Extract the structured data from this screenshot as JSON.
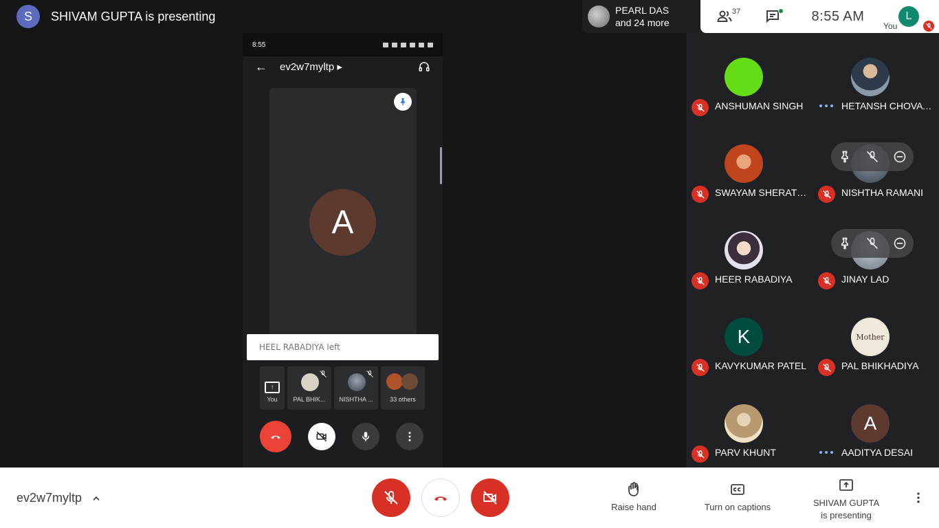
{
  "top_bar": {
    "presenter_initial": "S",
    "presenter_text": "SHIVAM GUPTA is presenting",
    "others_line1": "PEARL DAS",
    "others_line2": "and 24 more",
    "people_count": "37",
    "time": "8:55  AM",
    "you_initial": "L",
    "you_label": "You"
  },
  "phone": {
    "status_time": "8:55",
    "meeting_code": "ev2w7myltp",
    "main_tile_initial": "A",
    "toast": "HEEL RABADIYA left",
    "strip": [
      {
        "label": "You"
      },
      {
        "label": "PAL BHIK..."
      },
      {
        "label": "NISHTHA ..."
      },
      {
        "label": "33 others"
      }
    ]
  },
  "participants": [
    {
      "name": "ANSHUMAN SINGH",
      "avatar": "green-circle",
      "muted": true
    },
    {
      "name": "HETANSH CHOVAT...",
      "avatar": "photo",
      "muted": false
    },
    {
      "name": "SWAYAM SHERATH...",
      "avatar": "photo",
      "muted": true
    },
    {
      "name": "NISHTHA RAMANI",
      "avatar": "photo",
      "muted": true
    },
    {
      "name": "HEER RABADIYA",
      "avatar": "photo",
      "muted": true
    },
    {
      "name": "JINAY LAD",
      "avatar": "photo",
      "muted": true
    },
    {
      "name": "KAVYKUMAR PATEL",
      "avatar": "K",
      "muted": true
    },
    {
      "name": "PAL BHIKHADIYA",
      "avatar": "Mother image",
      "muted": true
    },
    {
      "name": "PARV KHUNT",
      "avatar": "photo",
      "muted": true
    },
    {
      "name": "AADITYA DESAI",
      "avatar": "A",
      "muted": false
    }
  ],
  "avatar_letters": {
    "kavy": "K",
    "aaditya": "A"
  },
  "mother_text": "Mother",
  "bottom": {
    "meeting_code": "ev2w7myltp",
    "raise_hand": "Raise hand",
    "captions": "Turn on captions",
    "present_line1": "SHIVAM GUPTA",
    "present_line2": "is presenting"
  },
  "colors": {
    "red": "#d93025",
    "accent_green": "#1e8e3e",
    "presenter_avatar": "#5c6bc0"
  }
}
